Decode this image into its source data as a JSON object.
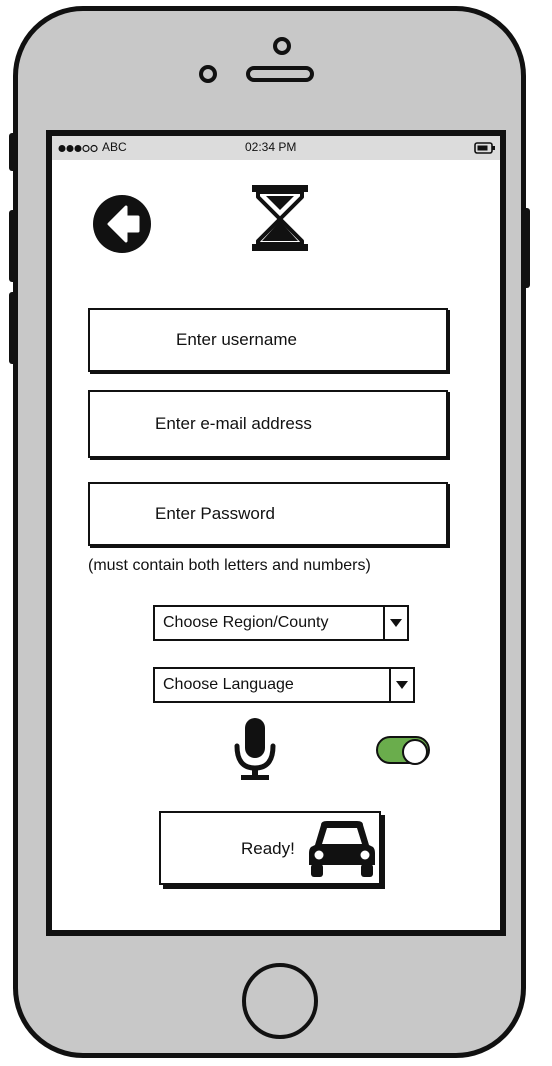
{
  "status_bar": {
    "carrier": "ABC",
    "time": "02:34 PM"
  },
  "header": {
    "back_icon": "back-arrow-circle-icon",
    "loading_icon": "hourglass-icon"
  },
  "form": {
    "username_placeholder": "Enter username",
    "email_placeholder": "Enter e-mail address",
    "password_placeholder": "Enter Password",
    "password_hint": "(must contain both letters and numbers)",
    "region_select": "Choose Region/County",
    "language_select": "Choose Language",
    "mic_icon": "microphone-icon",
    "toggle_state": "on",
    "ready_label": "Ready!",
    "ready_icon": "car-icon"
  },
  "colors": {
    "toggle_on": "#6aad4c",
    "phone_body": "#c8c8c8",
    "status_bar": "#dcdcdc"
  }
}
